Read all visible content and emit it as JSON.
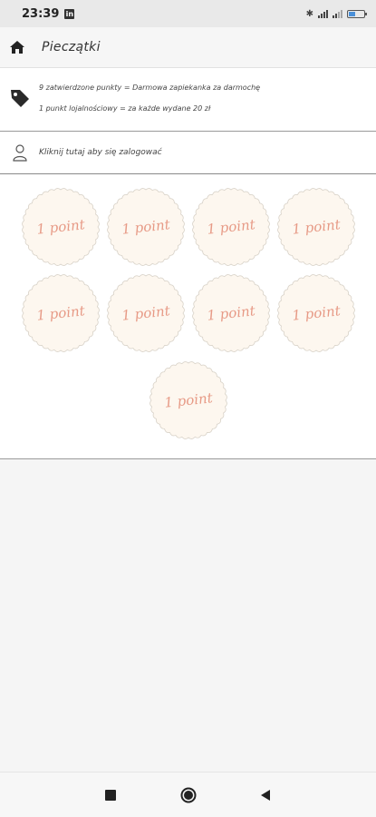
{
  "status_bar": {
    "time": "23:39",
    "notification_badge": "in",
    "battery_level_pct": 45,
    "accent_color": "#4a90d9"
  },
  "app_bar": {
    "title": "Pieczątki",
    "home_icon": "home-icon"
  },
  "info": {
    "icon": "tag-icon",
    "line1": "9 zatwierdzone punkty = Darmowa zapiekanka za darmochę",
    "line2": "1 punkt lojalnościowy = za każde wydane 20 zł"
  },
  "login": {
    "icon": "user-icon",
    "label": "Kliknij tutaj aby się zalogować"
  },
  "stamps": {
    "color_text": "#e79a86",
    "color_fill": "#fdf7ef",
    "items": [
      {
        "label": "1 point"
      },
      {
        "label": "1 point"
      },
      {
        "label": "1 point"
      },
      {
        "label": "1 point"
      },
      {
        "label": "1 point"
      },
      {
        "label": "1 point"
      },
      {
        "label": "1 point"
      },
      {
        "label": "1 point"
      },
      {
        "label": "1 point"
      }
    ]
  },
  "nav_bar": {
    "recents_icon": "square-icon",
    "home_icon": "circle-icon",
    "back_icon": "triangle-back-icon"
  }
}
